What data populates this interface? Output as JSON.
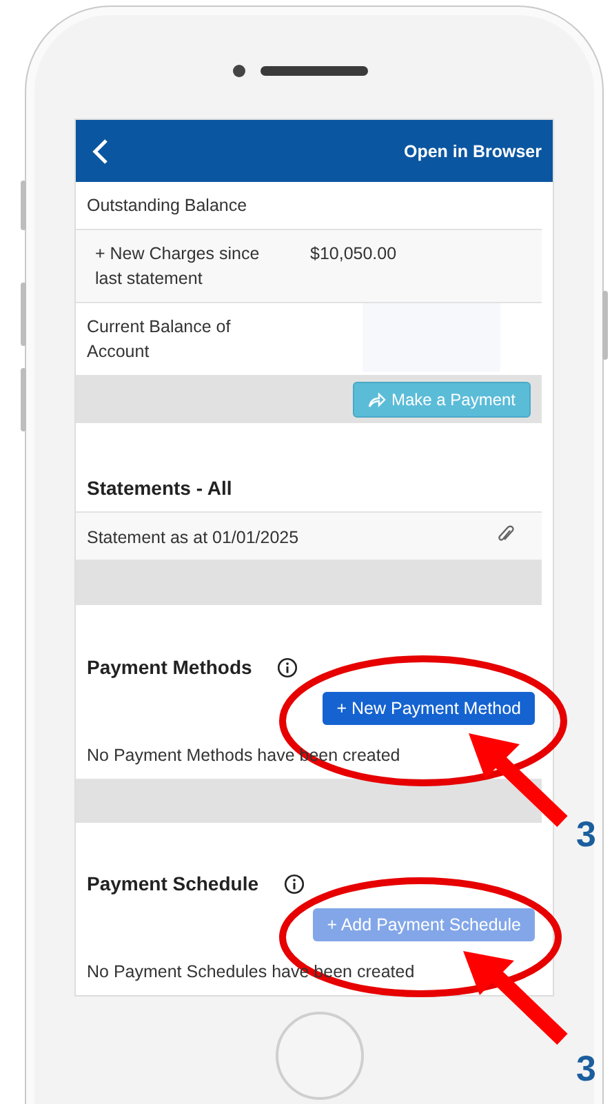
{
  "header": {
    "action": "Open in Browser"
  },
  "balance_rows": [
    {
      "label": "Outstanding Balance"
    },
    {
      "label": "+ New Charges since last statement",
      "value": "$10,050.00"
    },
    {
      "label": "Current Balance of Account"
    }
  ],
  "make_payment_button": "Make a Payment",
  "statements": {
    "title": "Statements - All",
    "rows": [
      "Statement as at 01/01/2025"
    ]
  },
  "payment_methods": {
    "title": "Payment Methods",
    "button": {
      "label": "+ New Payment Method",
      "disabled": false
    },
    "empty_text": "No Payment Methods have been created"
  },
  "payment_schedule": {
    "title": "Payment Schedule",
    "button": {
      "label": "+ Add Payment Schedule",
      "disabled": true
    },
    "empty_text": "No Payment Schedules have been created"
  },
  "annotations": [
    {
      "label": "3"
    },
    {
      "label": "3"
    }
  ]
}
